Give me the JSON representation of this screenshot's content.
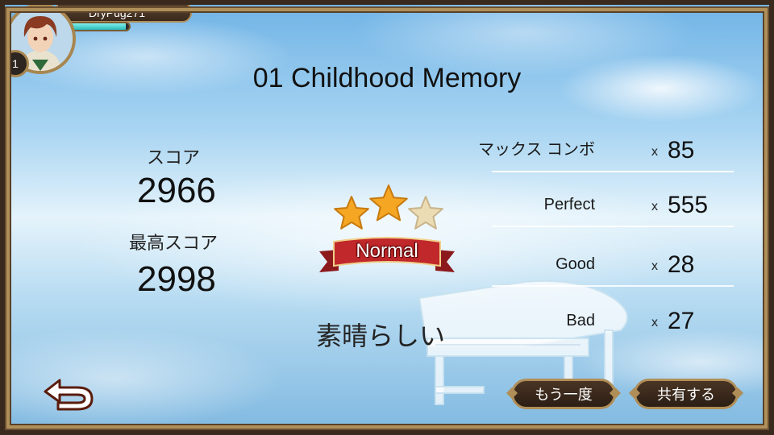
{
  "player": {
    "name": "DryPug271",
    "level": "1",
    "xp_fraction": 0.95
  },
  "song": {
    "title": "01 Childhood Memory"
  },
  "score": {
    "label": "スコア",
    "value": "2966",
    "best_label": "最高スコア",
    "best_value": "2998"
  },
  "result": {
    "stars_earned": 2,
    "stars_total": 3,
    "difficulty": "Normal",
    "comment": "素晴らしい"
  },
  "stats": [
    {
      "label": "マックス コンボ",
      "x": "x",
      "value": "85"
    },
    {
      "label": "Perfect",
      "x": "x",
      "value": "555"
    },
    {
      "label": "Good",
      "x": "x",
      "value": "28"
    },
    {
      "label": "Bad",
      "x": "x",
      "value": "27"
    }
  ],
  "buttons": {
    "retry": "もう一度",
    "share": "共有する"
  },
  "icons": {
    "back": "back-arrow-icon",
    "star": "star-icon"
  },
  "colors": {
    "star_gold": "#f5a623",
    "star_empty": "#ecdcb4",
    "ribbon": "#c0282b",
    "frame_gold": "#b0905a",
    "xp": "#2bb8b6"
  }
}
